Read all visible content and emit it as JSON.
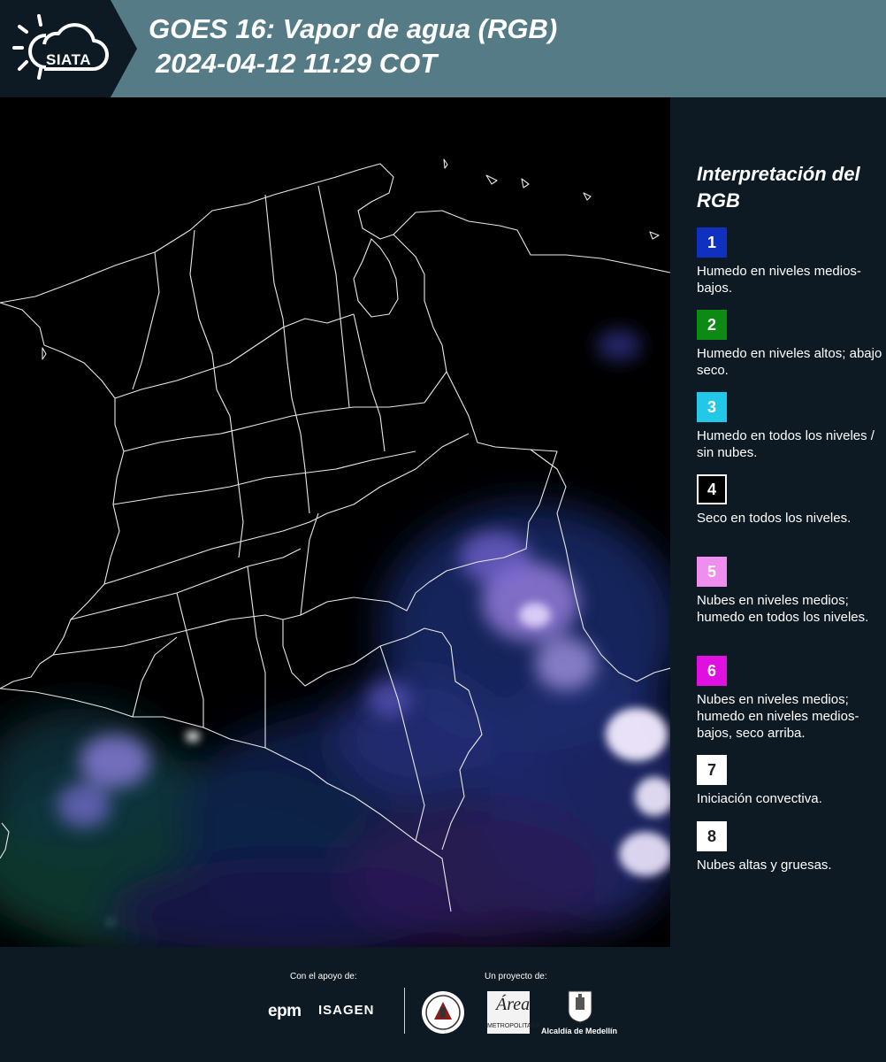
{
  "header": {
    "logo_text": "SIATA",
    "title_line1": "GOES 16: Vapor de agua (RGB)",
    "title_line2": "2024-04-12 11:29 COT",
    "band_color": "#557b86"
  },
  "legend": {
    "title": "Interpretación del RGB",
    "items": [
      {
        "num": "1",
        "color": "#1030c0",
        "text": "Humedo en niveles medios-bajos."
      },
      {
        "num": "2",
        "color": "#0d8a14",
        "text": "Humedo en niveles altos; abajo seco."
      },
      {
        "num": "3",
        "color": "#22c8e8",
        "text": "Humedo en todos los niveles / sin nubes."
      },
      {
        "num": "4",
        "color": "#000000",
        "text": "Seco en todos los niveles."
      },
      {
        "num": "5",
        "color": "#f08ef0",
        "text": "Nubes en niveles medios; humedo en todos los niveles."
      },
      {
        "num": "6",
        "color": "#e010e0",
        "text": "Nubes en niveles medios; humedo en niveles medios-bajos, seco arriba."
      },
      {
        "num": "7",
        "color": "#ffffff",
        "text": "Iniciación convectiva."
      },
      {
        "num": "8",
        "color": "#ffffff",
        "text": "Nubes altas y gruesas."
      }
    ]
  },
  "footer": {
    "support_label": "Con el apoyo de:",
    "project_label": "Un proyecto de:",
    "sponsor1": "epm",
    "sponsor2": "ISAGEN",
    "partner_area_name": "METROPOLITANA",
    "partner_alcaldia": "Alcaldía de Medellín"
  }
}
